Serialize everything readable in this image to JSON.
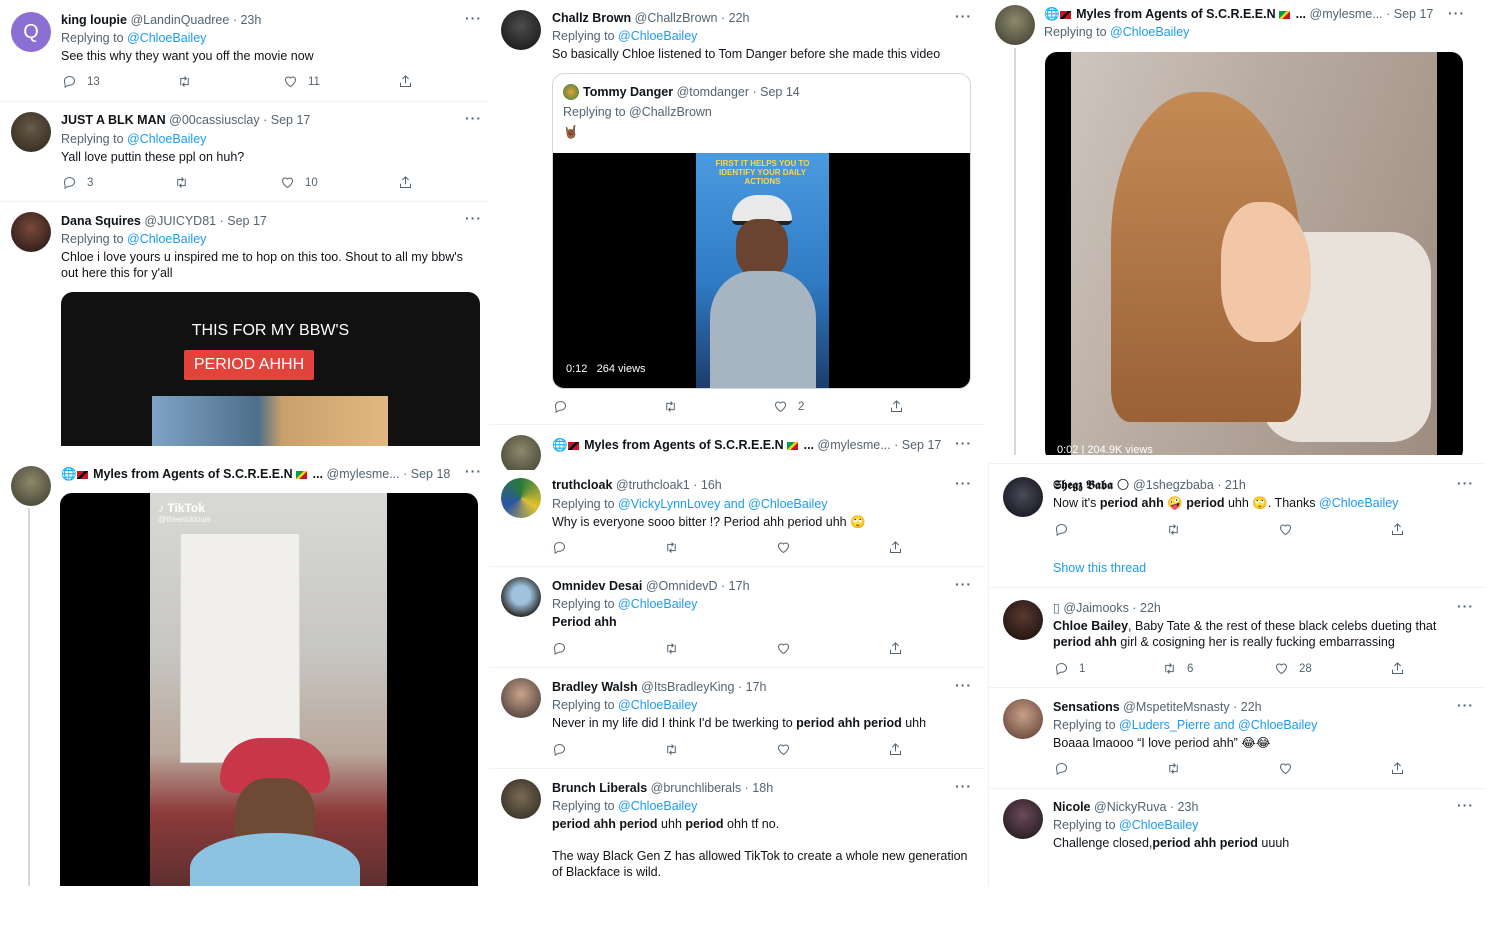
{
  "icons": {
    "reply": "reply-icon",
    "retweet": "retweet-icon",
    "like": "heart-icon",
    "share": "share-icon",
    "more": "more-icon"
  },
  "colors": {
    "link": "#1d9bf0",
    "muted": "#536471",
    "text": "#0f1419",
    "border": "#eff3f4"
  },
  "tl": {
    "t1": {
      "name": "king loupie",
      "handle": "@LandinQuadree",
      "time": "· 23h",
      "reply_prefix": "Replying to ",
      "reply_to": "@ChloeBailey",
      "text": "See this why they want you off the movie now",
      "replies": "13",
      "retweets": "",
      "likes": "11",
      "avatar_letter": "Q"
    },
    "t2": {
      "name": "JUST A BLK MAN",
      "handle": "@00cassiusclay",
      "time": "· Sep 17",
      "reply_prefix": "Replying to ",
      "reply_to": "@ChloeBailey",
      "text": "Yall love puttin these ppl on huh?",
      "replies": "3",
      "retweets": "",
      "likes": "10"
    },
    "t3": {
      "name": "Dana Squires",
      "handle": "@JUICYD81",
      "time": "· Sep 17",
      "reply_prefix": "Replying to ",
      "reply_to": "@ChloeBailey",
      "text": "Chloe i love yours u inspired me to hop on this too. Shout to all my bbw's out here this for y'all",
      "media_line1": "THIS FOR MY BBW'S",
      "media_line2": "PERIOD AHHH"
    }
  },
  "bl": {
    "t1": {
      "name": "Myles from Agents of S.C.R.E.E.N",
      "ellipsis": "...",
      "handle": "@mylesme...",
      "time": "· Sep 18",
      "tiktok_label": "TikTok",
      "tiktok_user": "@theericklouis"
    }
  },
  "tm": {
    "t1": {
      "name": "Challz Brown",
      "handle": "@ChallzBrown",
      "time": "· 22h",
      "reply_prefix": "Replying to ",
      "reply_to": "@ChloeBailey",
      "text": "So basically Chloe listened to Tom Danger before she made this video",
      "replies": "",
      "retweets": "",
      "likes": "2",
      "quote": {
        "name": "Tommy Danger",
        "handle": "@tomdanger",
        "time": "· Sep 14",
        "reply_prefix": "Replying to ",
        "reply_to": "@ChallzBrown",
        "text": "🤘🏾",
        "video_caption": "FIRST IT HELPS YOU TO IDENTIFY YOUR DAILY ACTIONS",
        "duration": "0:12",
        "views": "264 views"
      }
    },
    "t2": {
      "name": "Myles from Agents of S.C.R.E.E.N",
      "ellipsis": "...",
      "handle": "@mylesme...",
      "time": "· Sep 17"
    }
  },
  "bm": {
    "t1": {
      "name": "truthcloak",
      "handle": "@truthcloak1",
      "time": "· 16h",
      "reply_prefix": "Replying to ",
      "reply_to": "@VickyLynnLovey and @ChloeBailey",
      "text": "Why is everyone sooo bitter !? Period ahh period uhh 🙄"
    },
    "t2": {
      "name": "Omnidev Desai",
      "handle": "@OmnidevD",
      "time": "· 17h",
      "reply_prefix": "Replying to ",
      "reply_to": "@ChloeBailey",
      "text": "Period ahh"
    },
    "t3": {
      "name": "Bradley Walsh",
      "handle": "@ItsBradleyKing",
      "time": "· 17h",
      "reply_prefix": "Replying to ",
      "reply_to": "@ChloeBailey",
      "text_a": "Never in my life did I think I'd be twerking to ",
      "text_b": "period ahh period",
      "text_c": " uhh"
    },
    "t4": {
      "name": "Brunch Liberals",
      "handle": "@brunchliberals",
      "time": "· 18h",
      "reply_prefix": "Replying to ",
      "reply_to": "@ChloeBailey",
      "text_a": "period ahh period",
      "text_b": " uhh ",
      "text_c": "period",
      "text_d": " ohh tf no.",
      "text_e": "The way Black Gen Z has allowed TikTok to create a whole new generation of Blackface is wild."
    }
  },
  "tr": {
    "t1": {
      "name": "Myles from Agents of S.C.R.E.E.N",
      "ellipsis": "...",
      "handle": "@mylesme...",
      "time": "· Sep 17",
      "reply_prefix": "Replying to ",
      "reply_to": "@ChloeBailey",
      "duration": "0:02",
      "views": "204.9K views"
    }
  },
  "br": {
    "t1": {
      "name": "𝕾𝖍𝖊𝖌𝖟 𝕭𝖆𝖇𝖆",
      "handle": "@1shegzbaba",
      "time": "· 21h",
      "text_a": "Now it's ",
      "text_b": "period ahh",
      "text_c": " 🤪 ",
      "text_d": "period",
      "text_e": " uhh 🙄. Thanks ",
      "text_f": "@ChloeBailey",
      "show_thread": "Show this thread"
    },
    "t2": {
      "name": "",
      "handle": "@Jaimooks",
      "time": "· 22h",
      "text_a": "Chloe Bailey",
      "text_b": ", Baby Tate & the rest of these black celebs dueting that ",
      "text_c": "period ahh",
      "text_d": " girl & cosigning her is really fucking embarrassing",
      "replies": "1",
      "retweets": "6",
      "likes": "28"
    },
    "t3": {
      "name": "Sensations",
      "handle": "@MspetiteMsnasty",
      "time": "· 22h",
      "reply_prefix": "Replying to ",
      "reply_to": "@Luders_Pierre and @ChloeBailey",
      "text": "Boaaa lmaooo “I love period ahh” 😂😂"
    },
    "t4": {
      "name": "Nicole",
      "handle": "@NickyRuva",
      "time": "· 23h",
      "reply_prefix": "Replying to ",
      "reply_to": "@ChloeBailey",
      "text_a": "Challenge closed,",
      "text_b": "period ahh period",
      "text_c": " uuuh"
    }
  }
}
